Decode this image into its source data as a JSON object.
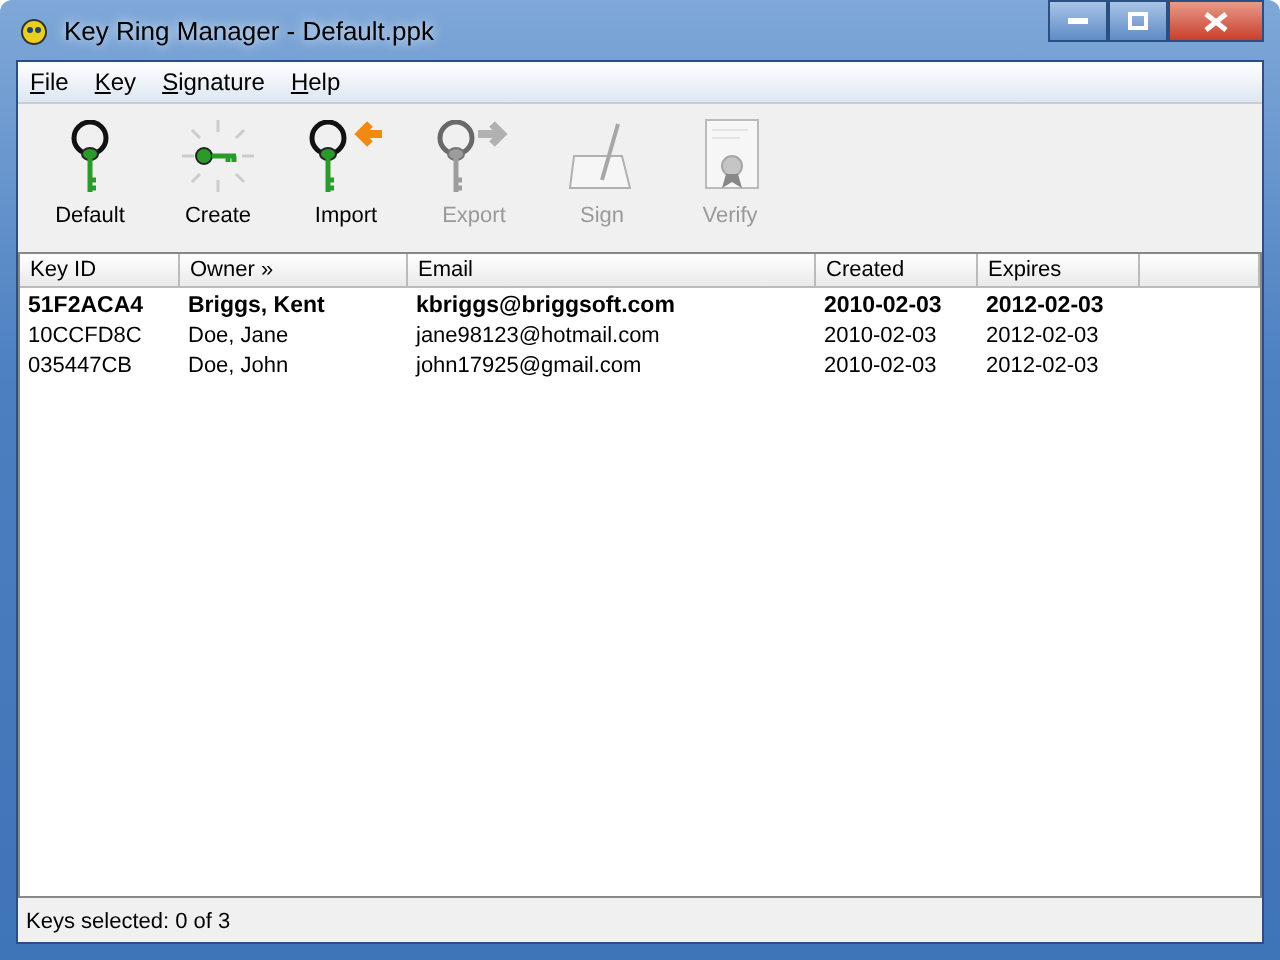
{
  "window": {
    "title": "Key Ring Manager - Default.ppk"
  },
  "menu": [
    "File",
    "Key",
    "Signature",
    "Help"
  ],
  "toolbar": [
    {
      "label": "Default",
      "kind": "default",
      "disabled": false
    },
    {
      "label": "Create",
      "kind": "create",
      "disabled": false
    },
    {
      "label": "Import",
      "kind": "import",
      "disabled": false
    },
    {
      "label": "Export",
      "kind": "export",
      "disabled": true
    },
    {
      "label": "Sign",
      "kind": "sign",
      "disabled": true
    },
    {
      "label": "Verify",
      "kind": "verify",
      "disabled": true
    }
  ],
  "table": {
    "columns": [
      "Key ID",
      "Owner »",
      "Email",
      "Created",
      "Expires"
    ],
    "rows": [
      {
        "cells": [
          "51F2ACA4",
          "Briggs, Kent",
          "kbriggs@briggsoft.com",
          "2010-02-03",
          "2012-02-03"
        ],
        "default": true
      },
      {
        "cells": [
          "10CCFD8C",
          "Doe, Jane",
          "jane98123@hotmail.com",
          "2010-02-03",
          "2012-02-03"
        ],
        "default": false
      },
      {
        "cells": [
          "035447CB",
          "Doe, John",
          "john17925@gmail.com",
          "2010-02-03",
          "2012-02-03"
        ],
        "default": false
      }
    ]
  },
  "status_bar": "Keys selected: 0 of 3"
}
